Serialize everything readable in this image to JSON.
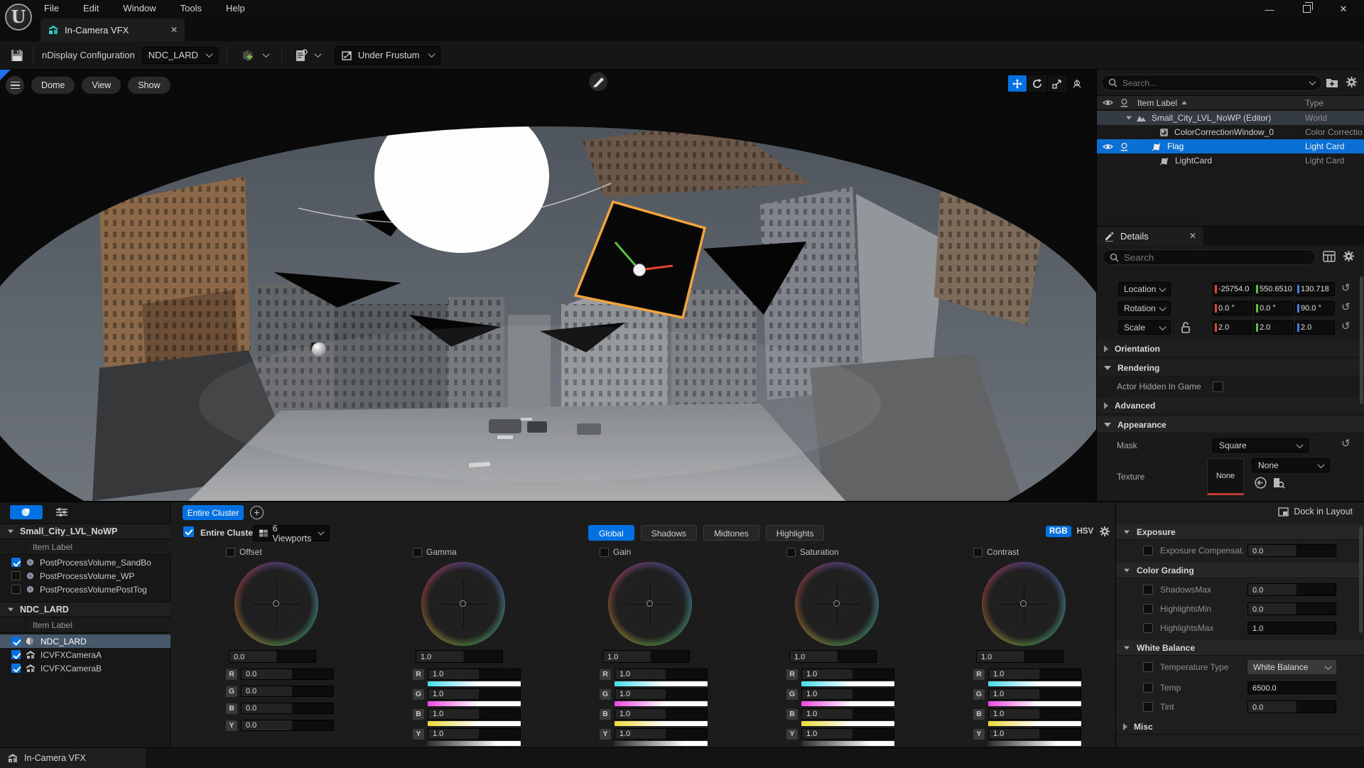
{
  "colors": {
    "accent_blue": "#0071e3",
    "flag_outline_orange": "#f2a33c",
    "axis_red": "#e8442e",
    "axis_green": "#57c53e",
    "axis_blue": "#3f7fe5",
    "grad_r_cyan": "#49dcec",
    "grad_g_magenta": "#ec49e0",
    "grad_b_yellow": "#ecd937"
  },
  "window": {
    "menu": [
      "File",
      "Edit",
      "Window",
      "Tools",
      "Help"
    ],
    "logo_glyph": "U"
  },
  "tabs": {
    "main_tab": "In-Camera VFX"
  },
  "toolbar": {
    "ndisplay_config_label": "nDisplay Configuration",
    "config_value": "NDC_LARD",
    "frustum_mode": "Under Frustum"
  },
  "viewport": {
    "menu_buttons": [
      "Dome",
      "View",
      "Show"
    ]
  },
  "outliner": {
    "search_placeholder": "Search...",
    "columns": {
      "item_label": "Item Label",
      "type": "Type"
    },
    "rows": [
      {
        "label": "Small_City_LVL_NoWP (Editor)",
        "type": "World"
      },
      {
        "label": "ColorCorrectionWindow_0",
        "type": "Color Correctio"
      },
      {
        "label": "Flag",
        "type": "Light Card"
      },
      {
        "label": "LightCard",
        "type": "Light Card"
      }
    ]
  },
  "details": {
    "tab_label": "Details",
    "search_placeholder": "Search",
    "transform": {
      "location": {
        "label": "Location",
        "x": "-25754.0",
        "y": "550.6510",
        "z": "130.718"
      },
      "rotation": {
        "label": "Rotation",
        "x": "0.0 °",
        "y": "0.0 °",
        "z": "90.0 °"
      },
      "scale": {
        "label": "Scale",
        "x": "2.0",
        "y": "2.0",
        "z": "2.0"
      }
    },
    "sections": {
      "orientation": "Orientation",
      "rendering": "Rendering",
      "advanced": "Advanced",
      "appearance": "Appearance"
    },
    "actor_hidden_label": "Actor Hidden In Game",
    "mask": {
      "label": "Mask",
      "value": "Square"
    },
    "texture": {
      "label": "Texture",
      "thumb_label": "None",
      "value": "None"
    }
  },
  "levels_panel": {
    "groups": [
      {
        "title": "Small_City_LVL_NoWP",
        "column_header": "Item Label",
        "rows": [
          {
            "label": "PostProcessVolume_SandBo",
            "checked": true
          },
          {
            "label": "PostProcessVolume_WP",
            "checked": false
          },
          {
            "label": "PostProcessVolumePostTog",
            "checked": false
          }
        ]
      },
      {
        "title": "NDC_LARD",
        "column_header": "Item Label",
        "rows": [
          {
            "label": "NDC_LARD",
            "checked": true,
            "selected": true
          },
          {
            "label": "ICVFXCameraA",
            "checked": true
          },
          {
            "label": "ICVFXCameraB",
            "checked": true
          }
        ]
      }
    ]
  },
  "color_grading": {
    "tab_label": "Entire Cluster",
    "cluster_checkbox_label": "Entire Cluster",
    "viewports_dropdown": "6 Viewports",
    "range_tabs": [
      "Global",
      "Shadows",
      "Midtones",
      "Highlights"
    ],
    "active_range": "Global",
    "mode_rgb": "RGB",
    "mode_hsv": "HSV",
    "active_mode": "RGB",
    "channels": [
      "R",
      "G",
      "B",
      "Y"
    ],
    "wheels": [
      {
        "label": "Offset",
        "main": "0.0",
        "r": "0.0",
        "g": "0.0",
        "b": "0.0",
        "y": "0.0"
      },
      {
        "label": "Gamma",
        "main": "1.0",
        "r": "1.0",
        "g": "1.0",
        "b": "1.0",
        "y": "1.0"
      },
      {
        "label": "Gain",
        "main": "1.0",
        "r": "1.0",
        "g": "1.0",
        "b": "1.0",
        "y": "1.0"
      },
      {
        "label": "Saturation",
        "main": "1.0",
        "r": "1.0",
        "g": "1.0",
        "b": "1.0",
        "y": "1.0"
      },
      {
        "label": "Contrast",
        "main": "1.0",
        "r": "1.0",
        "g": "1.0",
        "b": "1.0",
        "y": "1.0"
      }
    ]
  },
  "dock_button": "Dock in Layout",
  "settings_panel": {
    "sections": [
      {
        "title": "Exposure",
        "rows": [
          {
            "label": "Exposure Compensat...",
            "value": "0.0"
          }
        ]
      },
      {
        "title": "Color Grading",
        "rows": [
          {
            "label": "ShadowsMax",
            "value": "0.0"
          },
          {
            "label": "HighlightsMin",
            "value": "0.0"
          },
          {
            "label": "HighlightsMax",
            "value": "1.0"
          }
        ]
      },
      {
        "title": "White Balance",
        "rows": [
          {
            "label": "Temperature Type",
            "value": "White Balance"
          },
          {
            "label": "Temp",
            "value": "6500.0"
          },
          {
            "label": "Tint",
            "value": "0.0"
          }
        ]
      },
      {
        "title": "Misc",
        "rows": []
      }
    ]
  },
  "status_bar": {
    "label": "In-Camera VFX"
  }
}
